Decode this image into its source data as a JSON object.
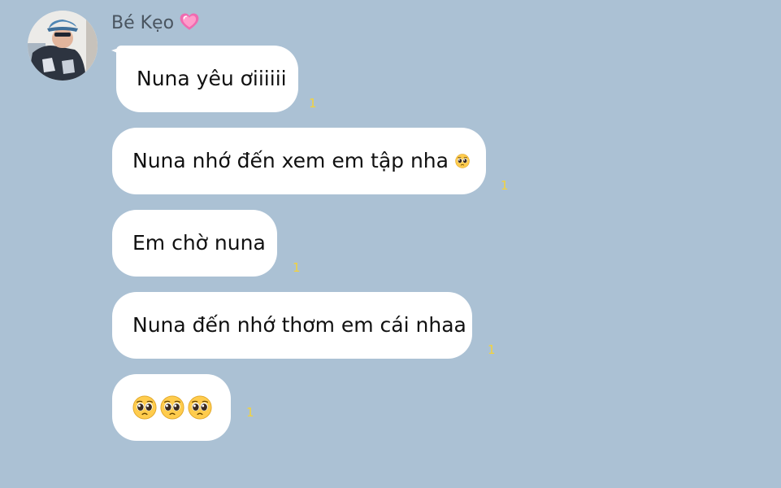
{
  "chat": {
    "sender_name": "Bé Kẹo",
    "sender_emoji": "pink-sparkling-heart-icon",
    "messages": [
      {
        "text": "Nuna yêu ơiiiiii",
        "read_count": "1"
      },
      {
        "text": "Nuna nhớ đến xem em tập nha",
        "emoji": "pleading-face-icon",
        "read_count": "1"
      },
      {
        "text": "Em chờ nuna",
        "read_count": "1"
      },
      {
        "text": "Nuna đến nhớ thơm em cái nhaa",
        "read_count": "1"
      },
      {
        "text": "",
        "emoji": "pleading-face-icon x3",
        "read_count": "1"
      }
    ]
  },
  "colors": {
    "background": "#abc1d4",
    "bubble": "#ffffff",
    "read_indicator": "#f4d33b",
    "name_text": "#4a5560"
  }
}
